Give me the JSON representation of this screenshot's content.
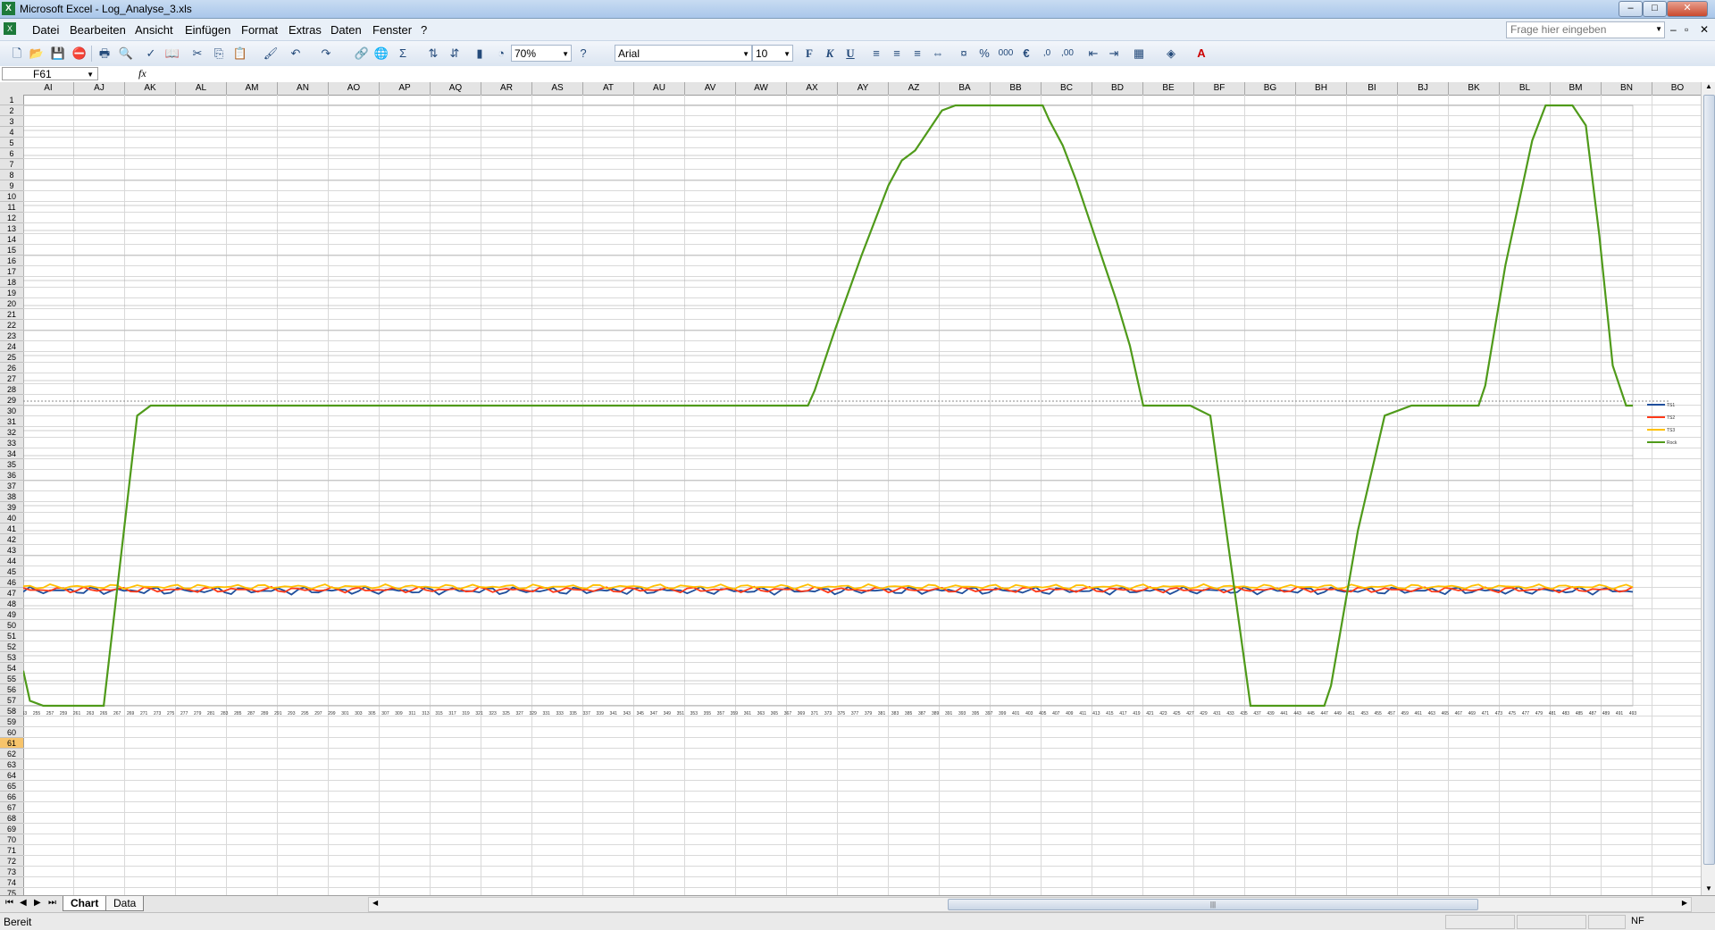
{
  "window": {
    "title": "Microsoft Excel - Log_Analyse_3.xls",
    "app_icon": "excel-icon",
    "minimize": "–",
    "maximize": "□",
    "close": "✕"
  },
  "menu": {
    "items": [
      "Datei",
      "Bearbeiten",
      "Ansicht",
      "Einfügen",
      "Format",
      "Extras",
      "Daten",
      "Fenster",
      "?"
    ],
    "help_placeholder": "Frage hier eingeben",
    "doc_minimize": "–",
    "doc_restore": "▫",
    "doc_close": "✕"
  },
  "toolbar": {
    "zoom": "70%",
    "font": "Arial",
    "size": "10",
    "bold": "F",
    "italic": "K",
    "underline": "U",
    "percent": "%",
    "thousands": "000",
    "euro": "€"
  },
  "formula": {
    "name_box": "F61",
    "fx": "fx",
    "content": ""
  },
  "columns": [
    "AI",
    "AJ",
    "AK",
    "AL",
    "AM",
    "AN",
    "AO",
    "AP",
    "AQ",
    "AR",
    "AS",
    "AT",
    "AU",
    "AV",
    "AW",
    "AX",
    "AY",
    "AZ",
    "BA",
    "BB",
    "BC",
    "BD",
    "BE",
    "BF",
    "BG",
    "BH",
    "BI",
    "BJ",
    "BK",
    "BL",
    "BM",
    "BN",
    "BO"
  ],
  "rows": {
    "first": 1,
    "last": 75,
    "active": 61
  },
  "sheet_tabs": [
    {
      "label": "Chart",
      "active": true
    },
    {
      "label": "Data",
      "active": false
    }
  ],
  "status": {
    "text": "Bereit",
    "indicator": "NF"
  },
  "chart_data": {
    "type": "line",
    "title": "",
    "xlabel": "",
    "ylabel": "",
    "x_range": [
      253,
      493
    ],
    "x_tick_step": 2,
    "y_range": [
      -6,
      6
    ],
    "reference_line": 0,
    "legend_position": "right",
    "series": [
      {
        "name": "TS1",
        "color": "#1f4e9c",
        "baseline": -3.7,
        "amplitude": 0.08
      },
      {
        "name": "TS2",
        "color": "#ff3a1a",
        "baseline": -3.68,
        "amplitude": 0.06
      },
      {
        "name": "TS3",
        "color": "#ffc000",
        "baseline": -3.62,
        "amplitude": 0.05
      },
      {
        "name": "Rock",
        "color": "#4f9a1a",
        "x": [
          253,
          254,
          256,
          260,
          265,
          270,
          272,
          275,
          280,
          300,
          340,
          370,
          371,
          374,
          378,
          382,
          384,
          386,
          388,
          390,
          392,
          394,
          396,
          398,
          400,
          405,
          406,
          408,
          410,
          412,
          414,
          416,
          418,
          420,
          426,
          427,
          430,
          436,
          440,
          443,
          447,
          448,
          452,
          456,
          460,
          462,
          470,
          471,
          474,
          478,
          480,
          481,
          484,
          486,
          488,
          490,
          492,
          493
        ],
        "y": [
          -5.3,
          -5.9,
          -6,
          -6,
          -6,
          -0.2,
          0,
          0,
          0,
          0,
          0,
          0,
          0.3,
          1.5,
          3.0,
          4.4,
          4.9,
          5.1,
          5.5,
          5.9,
          6,
          6,
          6,
          6,
          6,
          6,
          5.7,
          5.2,
          4.5,
          3.7,
          2.9,
          2.1,
          1.2,
          0,
          0,
          0,
          -0.2,
          -6,
          -6,
          -6,
          -6,
          -5.6,
          -2.5,
          -0.2,
          0,
          0,
          0,
          0.4,
          2.8,
          5.3,
          6,
          6,
          6,
          5.6,
          3.4,
          0.8,
          0,
          0
        ]
      }
    ]
  }
}
